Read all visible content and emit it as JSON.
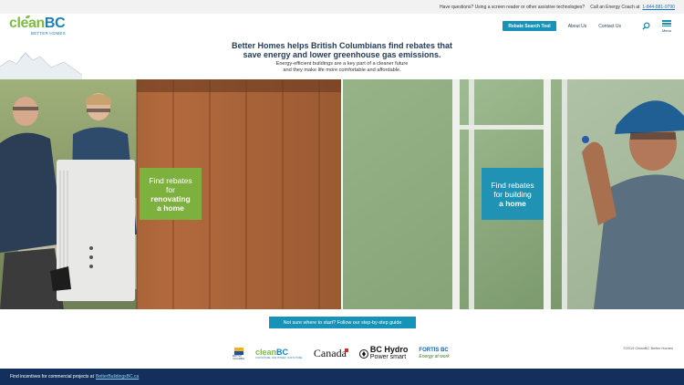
{
  "utility": {
    "help_text": "Have questions? Using a screen reader or other assistive technologies?",
    "call_text": "Call an Energy Coach at",
    "phone": "1-844-881-9790"
  },
  "header": {
    "logo_clean": "clean",
    "logo_bc": "BC",
    "logo_sub": "BETTER HOMES",
    "nav": {
      "rebate_search": "Rebate Search Tool",
      "about": "About Us",
      "contact": "Contact Us",
      "menu_label": "Menu"
    }
  },
  "hero": {
    "title_line1": "Better Homes helps British Columbians find rebates that",
    "title_line2": "save energy and lower greenhouse gas emissions.",
    "sub_line1": "Energy-efficient buildings are a key part of a cleaner future",
    "sub_line2": "and they make life more comfortable and affordable."
  },
  "cta": {
    "renovating": {
      "line1": "Find rebates",
      "line2": "for",
      "line3": "renovating",
      "line4": "a home"
    },
    "building": {
      "line1": "Find rebates",
      "line2": "for building",
      "line3": "a home"
    }
  },
  "guide_button": "Not sure where to start? Follow our step-by-step guide",
  "partners": {
    "bc_gov": "BRITISH COLUMBIA",
    "cleanbc_clean": "clean",
    "cleanbc_bc": "BC",
    "cleanbc_sub": "OUR NATURE. OUR POWER. OUR FUTURE.",
    "canada": "Canada",
    "bchydro_1": "BC Hydro",
    "bchydro_2": "Power smart",
    "fortis_1": "FORTIS BC",
    "fortis_2": "Energy at work"
  },
  "copyright": "©2019 CleanBC Better Homes",
  "footer": {
    "text": "Find incentives for commercial projects at",
    "link": "BetterBuildingsBC.ca"
  },
  "colors": {
    "brand_blue": "#1693b7",
    "brand_green": "#7dbb45",
    "navy": "#13305c"
  }
}
